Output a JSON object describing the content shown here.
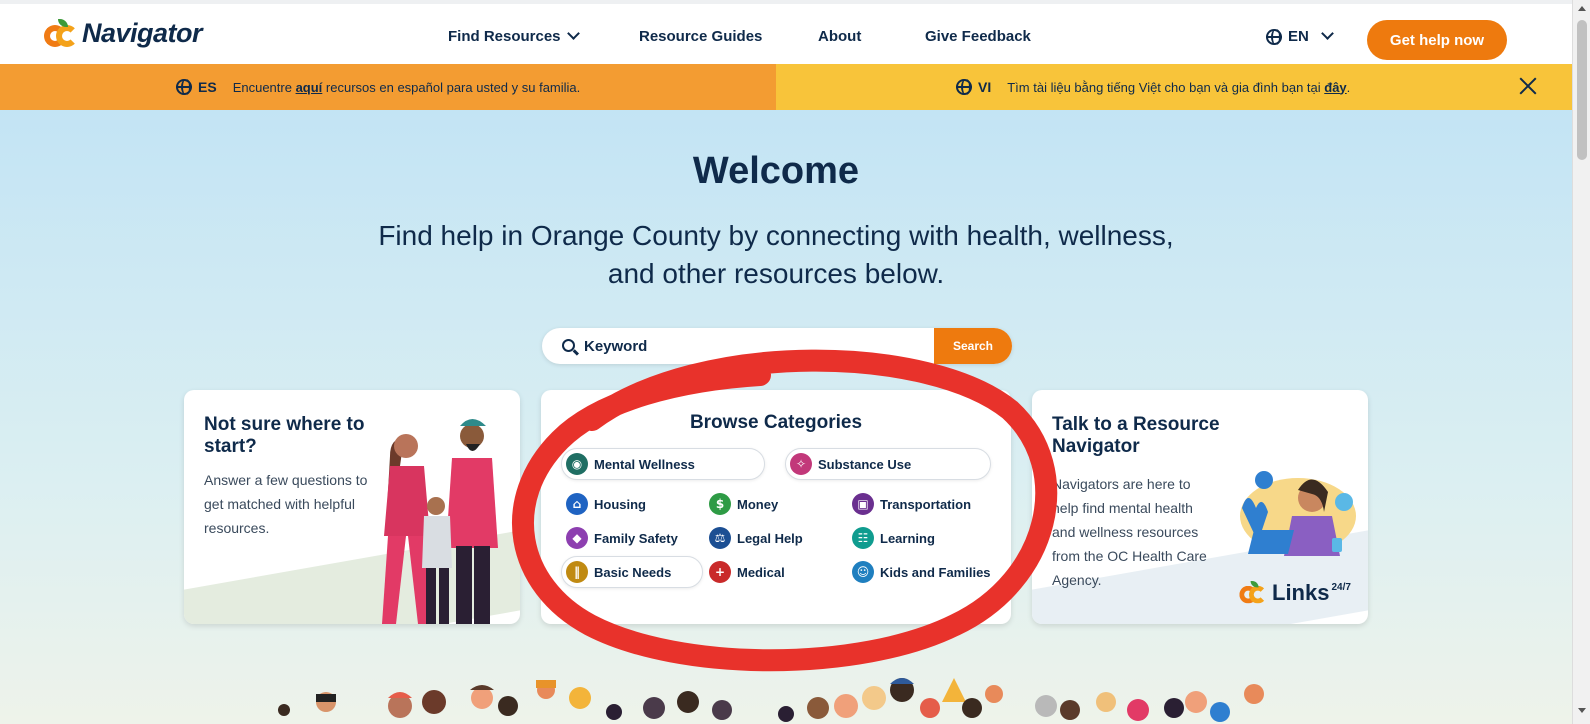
{
  "header": {
    "logo_text": "Navigator",
    "nav": [
      {
        "label": "Find Resources",
        "has_dropdown": true
      },
      {
        "label": "Resource Guides"
      },
      {
        "label": "About"
      },
      {
        "label": "Give Feedback"
      }
    ],
    "language": "EN",
    "cta_label": "Get help now"
  },
  "banners": {
    "es": {
      "code": "ES",
      "text_before": "Encuentre ",
      "link": "aquí",
      "text_after": " recursos en español para usted y su familia."
    },
    "vi": {
      "code": "VI",
      "text_before": "Tìm tài liệu bằng tiếng Việt cho bạn và gia đình bạn tại ",
      "link": "đây",
      "text_after": "."
    }
  },
  "hero": {
    "title": "Welcome",
    "subtitle_line1": "Find help in Orange County by connecting with health, wellness,",
    "subtitle_line2": "and other resources below."
  },
  "search": {
    "placeholder": "Keyword",
    "button_label": "Search"
  },
  "cards": {
    "left": {
      "title_line1": "Not sure where to",
      "title_line2": "start?",
      "body": [
        "Answer a few questions to",
        "get matched with helpful",
        "resources."
      ]
    },
    "middle": {
      "title": "Browse Categories",
      "categories": [
        {
          "label": "Mental Wellness",
          "color": "#1f6e63",
          "icon": "head-icon"
        },
        {
          "label": "Substance Use",
          "color": "#c2387a",
          "icon": "pills-icon"
        },
        {
          "label": "Housing",
          "color": "#1f63c2",
          "icon": "house-icon"
        },
        {
          "label": "Money",
          "color": "#2e9b45",
          "icon": "dollar-icon"
        },
        {
          "label": "Transportation",
          "color": "#6a2f8f",
          "icon": "bus-icon"
        },
        {
          "label": "Family Safety",
          "color": "#8d3fb0",
          "icon": "shield-icon"
        },
        {
          "label": "Legal Help",
          "color": "#1c4f93",
          "icon": "scales-icon"
        },
        {
          "label": "Learning",
          "color": "#0f9c8f",
          "icon": "book-icon"
        },
        {
          "label": "Basic Needs",
          "color": "#c08a12",
          "icon": "utensils-icon"
        },
        {
          "label": "Medical",
          "color": "#c92a2a",
          "icon": "cross-icon"
        },
        {
          "label": "Kids and Families",
          "color": "#1f7fbf",
          "icon": "child-icon"
        }
      ]
    },
    "right": {
      "title_line1": "Talk to a Resource",
      "title_line2": "Navigator",
      "body": [
        "Navigators are here to",
        "help find mental health",
        "and wellness resources",
        "from the OC Health Care",
        "Agency."
      ],
      "brand_text": "Links",
      "brand_sup": "24/7"
    }
  },
  "colors": {
    "navy": "#0f2a4a",
    "orange": "#ee7a0e",
    "banner_es": "#f39c32",
    "banner_vi": "#f8c43a",
    "annotation_red": "#e8322b"
  }
}
